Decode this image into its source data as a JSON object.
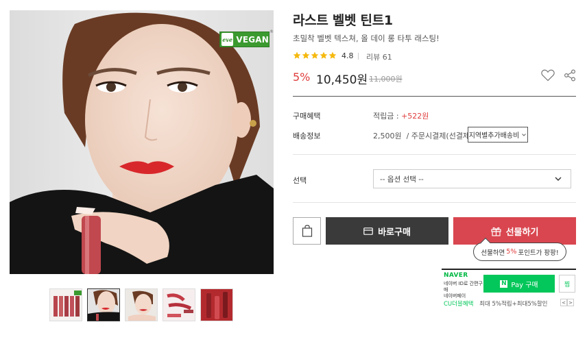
{
  "gallery": {
    "badge": {
      "brand_mark": "eve",
      "label": "VEGAN",
      "reg_mark": "®"
    },
    "thumbnails": [
      {
        "name": "thumb-product-lineup",
        "active": false
      },
      {
        "name": "thumb-model-front",
        "active": true
      },
      {
        "name": "thumb-model-pose",
        "active": false
      },
      {
        "name": "thumb-swatches",
        "active": false
      },
      {
        "name": "thumb-product-red",
        "active": false
      }
    ]
  },
  "product": {
    "title": "라스트 벨벳 틴트1",
    "subtitle": "초밀착 벨벳 텍스쳐, 올 데이 롱 타투 래스팅!",
    "rating": "4.8",
    "stars": 5,
    "review_label": "리뷰 61",
    "discount": "5%",
    "price": "10,450원",
    "original_price": "11,000원"
  },
  "info": {
    "benefit_label": "구매혜택",
    "benefit_prefix": "적립금 : ",
    "benefit_points": "+522원",
    "shipping_label": "배송정보",
    "shipping_value": "2,500원  / 주문시결제(선결제)",
    "region_button": "지역별추가배송비",
    "option_label": "선택",
    "option_placeholder": "-- 옵션 선택 --"
  },
  "actions": {
    "buy_label": "바로구매",
    "gift_label": "선물하기",
    "tooltip_prefix": "선물하면",
    "tooltip_pct": "5%",
    "tooltip_suffix": "포인트가 팡팡!"
  },
  "naver": {
    "logo": "NAVER",
    "sub_line1": "네이버 ID로 간편구매",
    "sub_line2": "네이버페이",
    "pay_n": "N",
    "pay_label": "Pay 구매",
    "zzim": "찜",
    "cu_label": "CU더블혜택",
    "cu_text": "최대 5%적립+최대5%할인",
    "prev": "<",
    "next": ">"
  },
  "colors": {
    "accent_red": "#e03c3c",
    "gift_red": "#d9464f",
    "buy_dark": "#3a3a3a",
    "naver_green": "#03c75a",
    "star": "#f5b90f"
  }
}
